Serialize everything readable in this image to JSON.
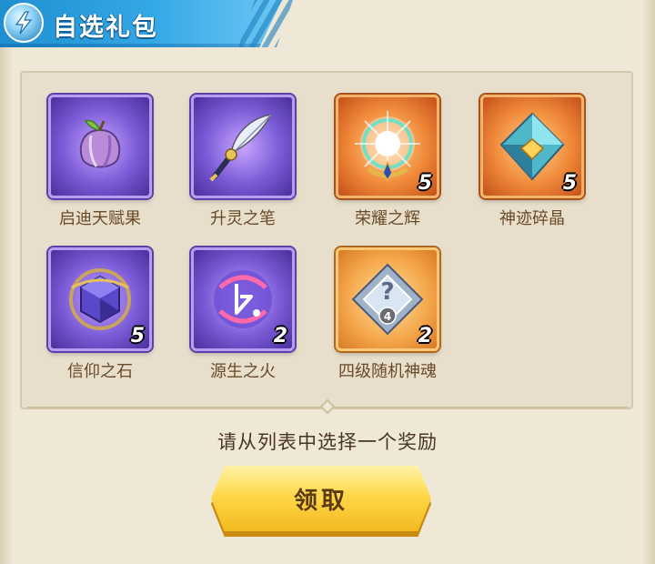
{
  "header": {
    "title": "自选礼包",
    "badge_icon": "lightning-shard-icon",
    "color": "#2a9ad8"
  },
  "rewards": [
    {
      "label": "启迪天赋果",
      "count": "",
      "icon": "fruit-icon",
      "rarity": "purple"
    },
    {
      "label": "升灵之笔",
      "count": "",
      "icon": "feather-pen-icon",
      "rarity": "purple"
    },
    {
      "label": "荣耀之辉",
      "count": "5",
      "icon": "radiant-orb-icon",
      "rarity": "orange"
    },
    {
      "label": "神迹碎晶",
      "count": "5",
      "icon": "crystal-shard-icon",
      "rarity": "orange"
    },
    {
      "label": "信仰之石",
      "count": "5",
      "icon": "faith-stone-icon",
      "rarity": "purple"
    },
    {
      "label": "源生之火",
      "count": "2",
      "icon": "origin-fire-icon",
      "rarity": "purple"
    },
    {
      "label": "四级随机神魂",
      "count": "2",
      "icon": "random-soul-icon",
      "rarity": "gold",
      "level": "4"
    }
  ],
  "instruction": "请从列表中选择一个奖励",
  "claim_button": "领取",
  "colors": {
    "panel": "#e7dfcb",
    "label_text": "#6b4a2a",
    "button": "#ffd84a"
  }
}
